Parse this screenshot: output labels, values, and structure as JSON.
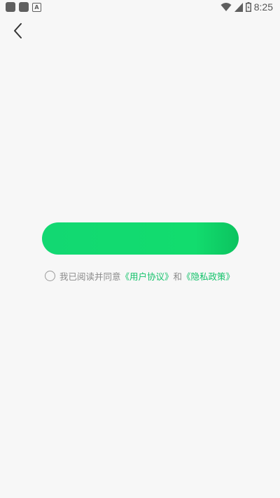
{
  "status_bar": {
    "app_badge": "A",
    "time": "8:25"
  },
  "icons": {
    "back": "chevron-left-icon",
    "wifi": "wifi-icon",
    "signal": "signal-icon",
    "battery": "battery-icon"
  },
  "main_button": {
    "label": ""
  },
  "agreement": {
    "text": "我已阅读并同意",
    "user_agreement": "《用户协议》",
    "and": "和",
    "privacy_policy": "《隐私政策》"
  },
  "colors": {
    "background": "#f7f7f7",
    "accent": "#12d872",
    "link": "#13c26a"
  }
}
